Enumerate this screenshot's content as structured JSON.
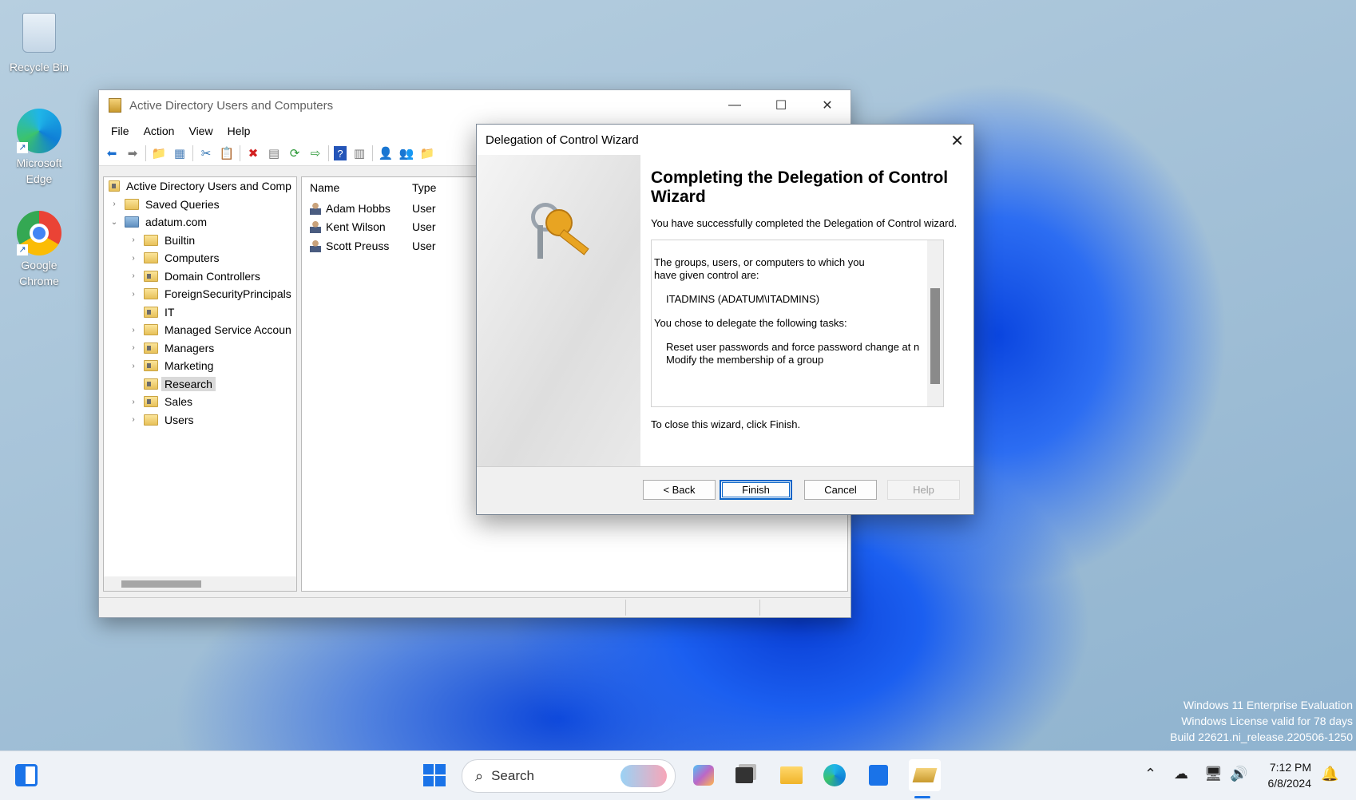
{
  "desktop": {
    "icons": [
      {
        "label": "Recycle Bin"
      },
      {
        "label": "Microsoft Edge"
      },
      {
        "label": "Google Chrome"
      }
    ],
    "watermark": {
      "line1": "Windows 11 Enterprise Evaluation",
      "line2": "Windows License valid for 78 days",
      "line3": "Build 22621.ni_release.220506-1250"
    }
  },
  "ad_window": {
    "title": "Active Directory Users and Computers",
    "menu": [
      "File",
      "Action",
      "View",
      "Help"
    ],
    "tree": {
      "root": "Active Directory Users and Comp",
      "saved_queries": "Saved Queries",
      "domain": "adatum.com",
      "children": [
        "Builtin",
        "Computers",
        "Domain Controllers",
        "ForeignSecurityPrincipals",
        "IT",
        "Managed Service Accoun",
        "Managers",
        "Marketing",
        "Research",
        "Sales",
        "Users"
      ],
      "selected": "Research"
    },
    "list": {
      "headers": {
        "name": "Name",
        "type": "Type"
      },
      "rows": [
        {
          "name": "Adam Hobbs",
          "type": "User"
        },
        {
          "name": "Kent Wilson",
          "type": "User"
        },
        {
          "name": "Scott Preuss",
          "type": "User"
        }
      ]
    }
  },
  "wizard": {
    "title": "Delegation of Control Wizard",
    "heading": "Completing the Delegation of Control Wizard",
    "intro": "You have successfully completed the Delegation of Control wizard.",
    "summary": {
      "line1": "The groups, users, or computers to which you",
      "line2": "have given control are:",
      "principal": "ITADMINS (ADATUM\\ITADMINS)",
      "tasks_label": "You chose to delegate the following tasks:",
      "task1": "Reset user passwords and force password change at n",
      "task2": "Modify the membership of a group"
    },
    "close_text": "To close this wizard, click Finish.",
    "buttons": {
      "back": "< Back",
      "finish": "Finish",
      "cancel": "Cancel",
      "help": "Help"
    }
  },
  "taskbar": {
    "search_placeholder": "Search",
    "time": "7:12 PM",
    "date": "6/8/2024"
  }
}
